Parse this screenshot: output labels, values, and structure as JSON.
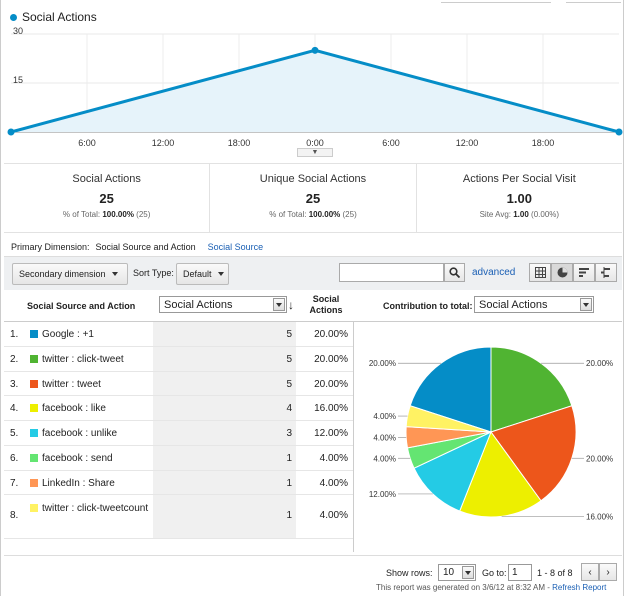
{
  "legend": {
    "label": "Social Actions",
    "color": "#058dc7"
  },
  "chart_data": {
    "type": "area",
    "x": [
      "",
      "6:00",
      "12:00",
      "18:00",
      "0:00",
      "6:00",
      "12:00",
      "18:00",
      ""
    ],
    "y_ticks": [
      "30",
      "15"
    ],
    "ylim": [
      0,
      30
    ],
    "series": [
      {
        "name": "Social Actions",
        "values": [
          0,
          25,
          0
        ]
      }
    ],
    "series_x_positions": [
      "start",
      "0:00",
      "end"
    ],
    "grid": true
  },
  "summary": [
    {
      "label": "Social Actions",
      "value": "25",
      "sub_prefix": "% of Total: ",
      "sub_bold": "100.00%",
      "sub_suffix": " (25)"
    },
    {
      "label": "Unique Social Actions",
      "value": "25",
      "sub_prefix": "% of Total: ",
      "sub_bold": "100.00%",
      "sub_suffix": " (25)"
    },
    {
      "label": "Actions Per Social Visit",
      "value": "1.00",
      "sub_prefix": "Site Avg: ",
      "sub_bold": "1.00",
      "sub_suffix": " (0.00%)"
    }
  ],
  "primary_dimension": {
    "label": "Primary Dimension:",
    "active": "Social Source and Action",
    "alt": "Social Source"
  },
  "toolbar": {
    "secondary_dimension": "Secondary dimension",
    "sort_type_label": "Sort Type:",
    "sort_type_value": "Default",
    "advanced": "advanced"
  },
  "table": {
    "col_dimension": "Social Source and Action",
    "col_metric_select": "Social Actions",
    "col_metric_header": "Social Actions",
    "contribution_label": "Contribution to total:",
    "contribution_select": "Social Actions",
    "rows": [
      {
        "num": "1.",
        "name": "Google : +1",
        "value": "5",
        "pct": "20.00%",
        "color": "#058dc7"
      },
      {
        "num": "2.",
        "name": "twitter : click-tweet",
        "value": "5",
        "pct": "20.00%",
        "color": "#50b432"
      },
      {
        "num": "3.",
        "name": "twitter : tweet",
        "value": "5",
        "pct": "20.00%",
        "color": "#ed561b"
      },
      {
        "num": "4.",
        "name": "facebook : like",
        "value": "4",
        "pct": "16.00%",
        "color": "#edef00"
      },
      {
        "num": "5.",
        "name": "facebook : unlike",
        "value": "3",
        "pct": "12.00%",
        "color": "#24cbe5"
      },
      {
        "num": "6.",
        "name": "facebook : send",
        "value": "1",
        "pct": "4.00%",
        "color": "#64e572"
      },
      {
        "num": "7.",
        "name": "LinkedIn : Share",
        "value": "1",
        "pct": "4.00%",
        "color": "#ff9655"
      },
      {
        "num": "8.",
        "name": "twitter : click-tweetcount",
        "value": "1",
        "pct": "4.00%",
        "color": "#fff263"
      }
    ]
  },
  "pie_data": {
    "type": "pie",
    "values": [
      20,
      20,
      20,
      16,
      12,
      4,
      4,
      4
    ],
    "labels": [
      "20.00%",
      "20.00%",
      "20.00%",
      "16.00%",
      "12.00%",
      "4.00%",
      "4.00%",
      "4.00%"
    ],
    "colors": [
      "#058dc7",
      "#50b432",
      "#ed561b",
      "#edef00",
      "#24cbe5",
      "#64e572",
      "#ff9655",
      "#fff263"
    ]
  },
  "footer": {
    "show_rows_label": "Show rows:",
    "show_rows_value": "10",
    "goto_label": "Go to:",
    "goto_value": "1",
    "range": "1 - 8 of 8",
    "prev": "‹",
    "next": "›",
    "note": "This report was generated on 3/6/12 at 8:32 AM - ",
    "refresh": "Refresh Report"
  }
}
